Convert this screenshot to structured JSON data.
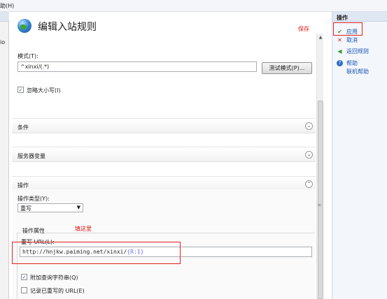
{
  "menubar": {
    "help_menu": "助(H)"
  },
  "left_panel": {
    "cut_text": "io"
  },
  "title": {
    "text": "编辑入站规则",
    "save_annotation": "保存"
  },
  "pattern": {
    "label": "模式(T):",
    "value": "^xinxi/(.*)",
    "test_button": "测试模式(P)...",
    "ignore_case": {
      "label": "忽略大小写(I)",
      "checked": true
    }
  },
  "sections": {
    "conditions": "条件",
    "server_vars": "服务器变量",
    "action": "操作"
  },
  "action": {
    "type_label": "操作类型(Y):",
    "type_value": "重写",
    "props_label": "操作属性",
    "fill_annotation": "填这里",
    "url_label": "重写 URL(L):",
    "url_prefix": "http://hnjkw.paiming.net/xinxi/",
    "url_var": "{R:1}",
    "append_query": {
      "label": "附加查询字符串(Q)",
      "checked": true
    },
    "log_rewritten": {
      "label": "记录已重写的 URL(E)",
      "checked": false
    }
  },
  "actions_pane": {
    "header": "操作",
    "items": [
      {
        "label": "应用",
        "icon": "apply-icon"
      },
      {
        "label": "取消",
        "icon": "cancel-icon"
      },
      {
        "label": "返回规则",
        "icon": "back-arrow-icon"
      },
      {
        "label": "帮助",
        "icon": "help-icon"
      },
      {
        "label": "联机帮助",
        "icon": ""
      }
    ]
  },
  "colors": {
    "annotation_red": "#e01010",
    "link_blue": "#1a56b3",
    "variable_blue": "#6a6aff"
  }
}
